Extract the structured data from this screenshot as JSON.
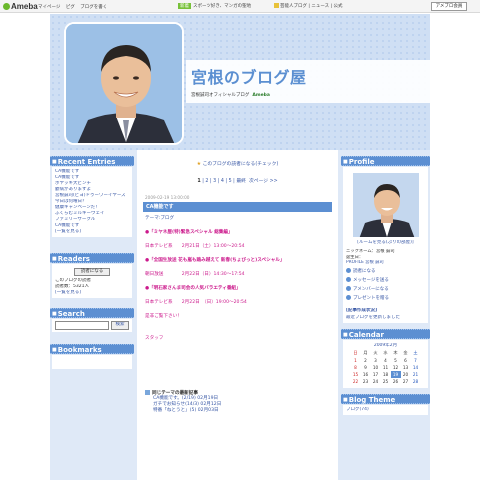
{
  "topbar": {
    "logo": "Ameba",
    "nav": [
      "マイページ",
      "ピグ",
      "ブログを書く"
    ],
    "promo_badge": "新着",
    "promo_text": "スポーツ好き、マンガの聖地",
    "promo2_text": "芸能人ブログ | ニュース | 公式",
    "login_label": "アメブロ会員"
  },
  "header": {
    "title": "宮根のブログ屋",
    "subtitle": "宮根誠司オフィシャルブログ",
    "powered": "Ameba"
  },
  "left": {
    "recent_heading": "Recent Entries",
    "recent_items": [
      "CA機能です",
      "CA機能です",
      "ボヤッキ大ピンチ",
      "鬱病がありますよ",
      "宮根誠司(ピヨ)ドゥーワーイヤーズ",
      "今日は何曜日？",
      "健康キャンペーンだ！",
      "ふくらむミルキーウェイ",
      "ファミリーサークル",
      "CA機能です"
    ],
    "recent_more": "[一覧を見る]",
    "readers_heading": "Readers",
    "readers_btn": "読者になる",
    "readers_text": "このブログの読者",
    "readers_line": "読者数：5321人",
    "readers_more": "[一覧を見る]",
    "search_heading": "Search",
    "search_btn": "検索",
    "bookmarks_heading": "Bookmarks"
  },
  "center": {
    "notice": "このブログの読者になる(チェック)",
    "pager": [
      "1",
      "2",
      "3",
      "4",
      "5"
    ],
    "pager_current": "1",
    "pager_last": "最終",
    "pager_next": "次ページ >>",
    "entry_date": "2009-02-19 13:00:00",
    "entry_title": "CA機能です",
    "theme_label": "テーマ:ブログ",
    "items": [
      {
        "title": "●「ミヤネ屋(特)緊急スペシャル 総集編」",
        "line": "日本テレビ系　　2月21日（土）13:00～20:54"
      },
      {
        "title": "●「全国生放送 花も嵐も踏み越えて 新春(ちょびっと)スペシャル」",
        "line": "朝日放送　　　　2月22日（日）14:30～17:54"
      },
      {
        "title": "●「明石家さんま司会の人気バラエティ番組」",
        "line": "日本テレビ系　　2月22日　（日）19:00～20:54"
      }
    ],
    "closing": "是非ご覧下さい！",
    "staff": "スタッフ",
    "related_heading": "同じテーマの最新記事",
    "related_items": [
      "CA機能です。(2/19) 02月19日",
      "ガチでお知らせ(14/3) 02月12日",
      "特番「ねとうと」(5) 02月03日"
    ]
  },
  "right": {
    "profile_heading": "Profile",
    "profile_link": "[ルームを見る(ぷりの部屋)]",
    "profile_lines": [
      "ニックネーム：宮根 誠司",
      "誕生日：",
      "PROFILE 宮根 誠司"
    ],
    "profile_btns": [
      "読者になる",
      "メッセージを送る",
      "アメンバーになる",
      "プレゼントを贈る"
    ],
    "updated": "[記事作成状況]",
    "updated_sub": "最近ブログを更新しました",
    "calendar_heading": "Calendar",
    "calendar_month": "2009年2月",
    "weekdays": [
      "日",
      "月",
      "火",
      "水",
      "木",
      "金",
      "土"
    ],
    "weeks": [
      [
        "1",
        "2",
        "3",
        "4",
        "5",
        "6",
        "7"
      ],
      [
        "8",
        "9",
        "10",
        "11",
        "12",
        "13",
        "14"
      ],
      [
        "15",
        "16",
        "17",
        "18",
        "19",
        "20",
        "21"
      ],
      [
        "22",
        "23",
        "24",
        "25",
        "26",
        "27",
        "28"
      ]
    ],
    "highlight_day": "19",
    "theme_heading": "Blog Theme",
    "theme_item": "ブログ(74)"
  }
}
